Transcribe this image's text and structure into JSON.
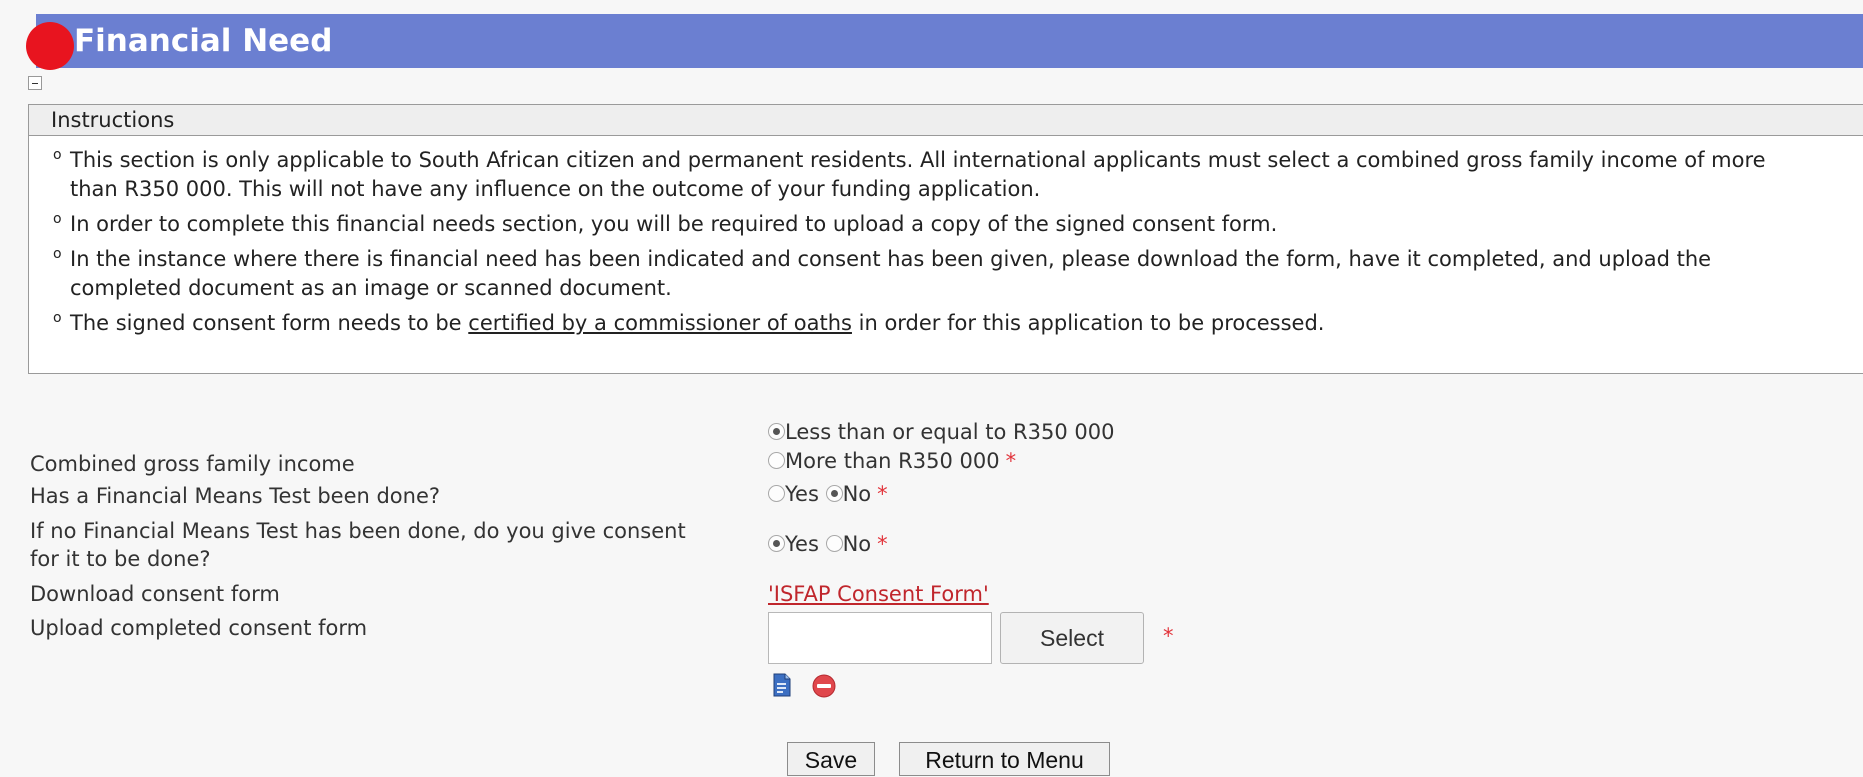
{
  "header": {
    "title": "Financial Need"
  },
  "instructions": {
    "heading": "Instructions",
    "items": [
      "This section is only applicable to South African citizen and permanent residents. All international applicants must select a combined gross family income of more than R350 000. This will not have any influence on the outcome of your funding application.",
      "In order to complete this financial needs section, you will be required to upload a copy of the signed consent form.",
      "In the instance where there is financial need has been indicated and consent has been given, please download the form, have it completed, and upload the completed document as an image or scanned document."
    ],
    "last_item": {
      "before": "The signed consent form needs to be ",
      "link": "certified by a commissioner of oaths",
      "after": " in order for this application to be processed."
    },
    "bullet": "o"
  },
  "form": {
    "income": {
      "label": "Combined gross family income",
      "options": [
        "Less than or equal to R350 000",
        "More than R350 000"
      ],
      "selected": 0,
      "required_mark": "*"
    },
    "means_test": {
      "label": "Has a Financial Means Test been done?",
      "options": [
        "Yes",
        "No"
      ],
      "selected": 1,
      "required_mark": "*"
    },
    "consent": {
      "label": "If no Financial Means Test has been done, do you give consent for it to be done?",
      "options": [
        "Yes",
        "No"
      ],
      "selected": 0,
      "required_mark": "*"
    },
    "download": {
      "label": "Download consent form",
      "link": "'ISFAP Consent Form'"
    },
    "upload": {
      "label": "Upload completed consent form",
      "value": "",
      "select_label": "Select",
      "required_mark": "*"
    }
  },
  "actions": {
    "save": "Save",
    "return": "Return to Menu"
  },
  "colors": {
    "header_bar": "#6b7fd1",
    "header_dot": "#e8141f",
    "required": "#e2343b",
    "link": "#c0262c"
  },
  "icons": [
    "document-icon",
    "remove-icon"
  ]
}
